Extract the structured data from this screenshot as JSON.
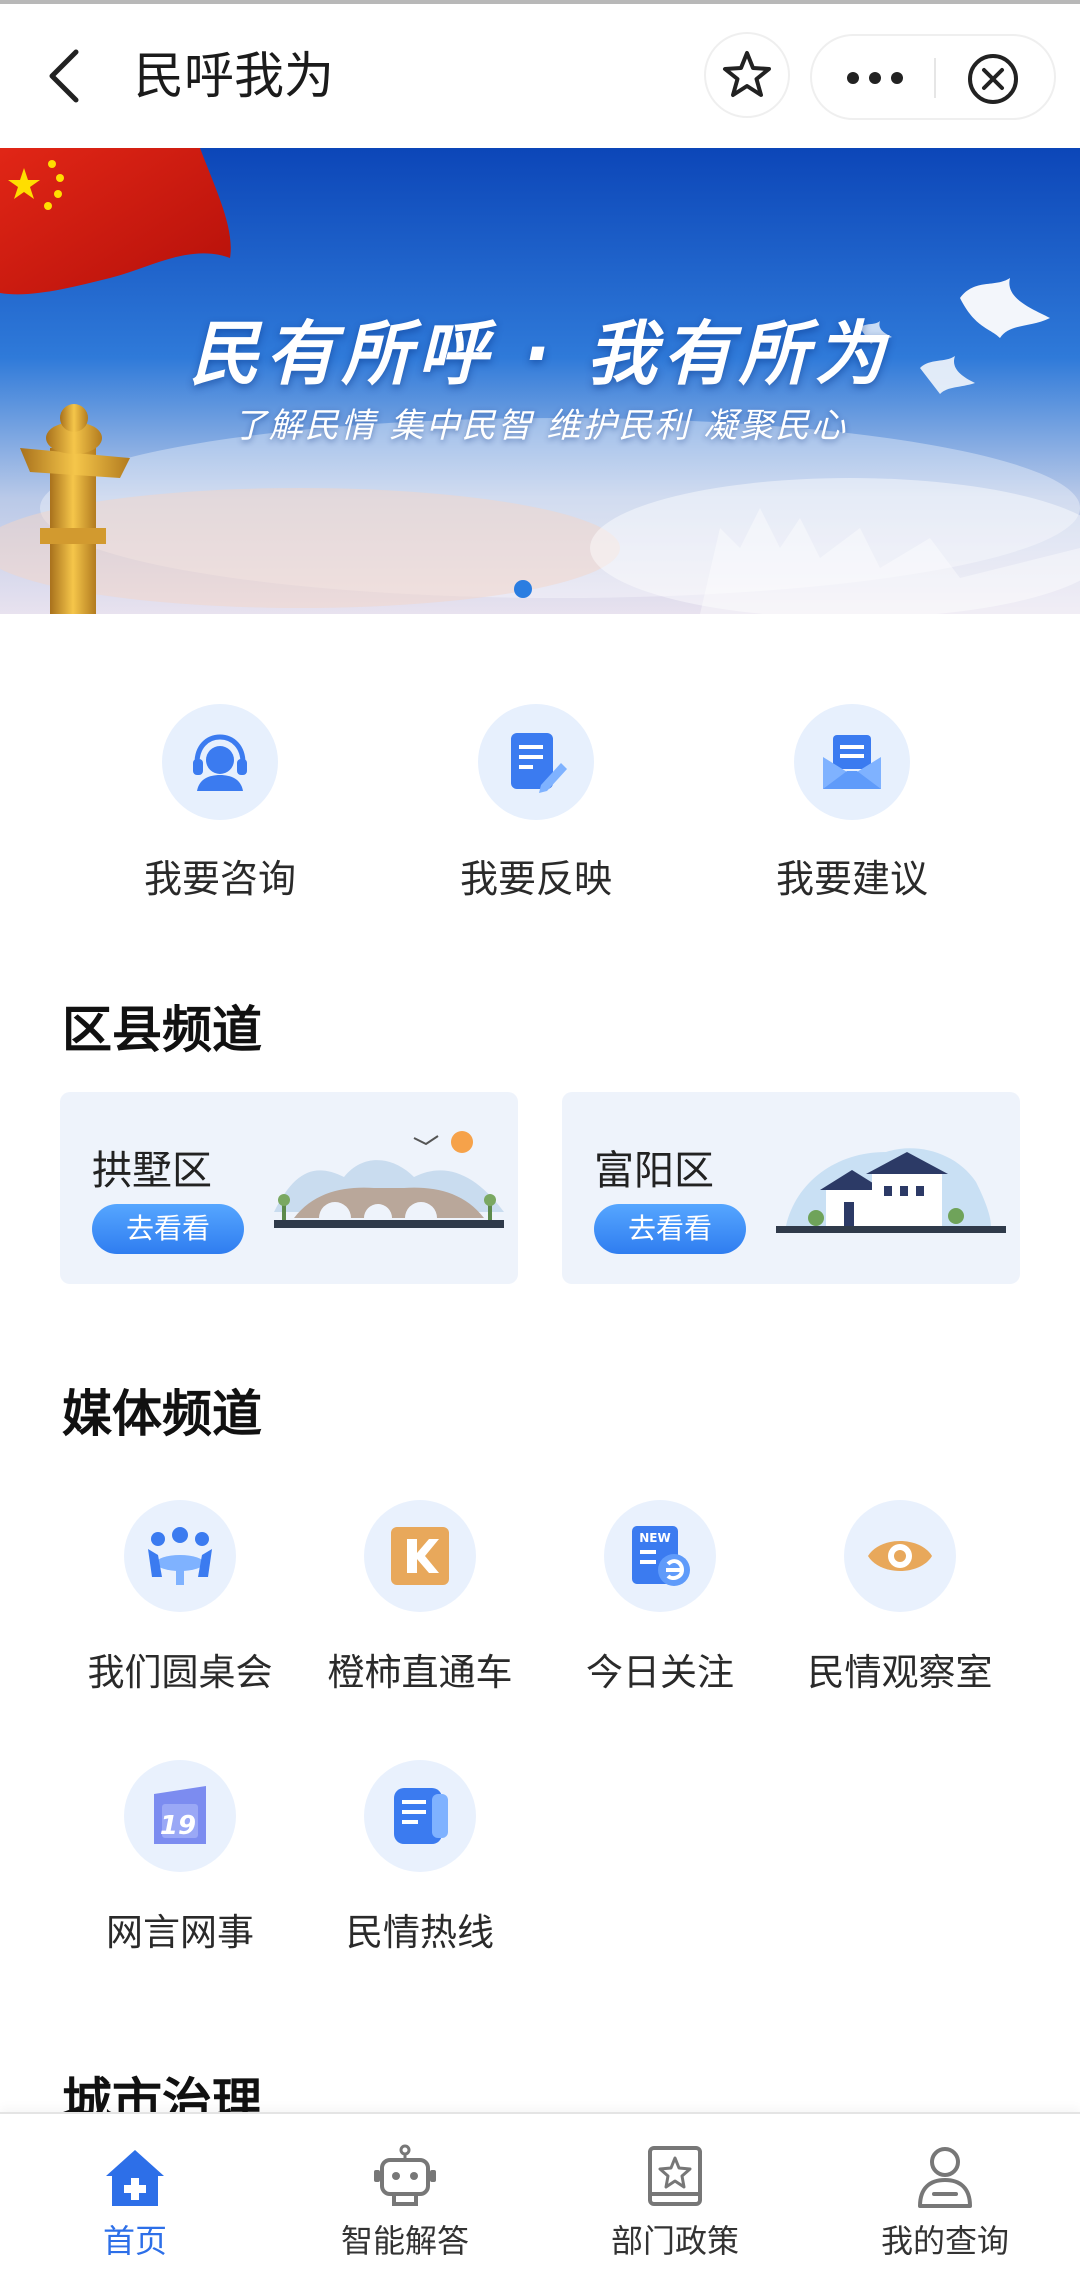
{
  "header": {
    "title": "民呼我为"
  },
  "banner": {
    "title": "民有所呼 · 我有所为",
    "subtitle": "了解民情 集中民智 维护民利 凝聚民心"
  },
  "quick_actions": [
    {
      "label": "我要咨询",
      "icon": "customer-service-icon"
    },
    {
      "label": "我要反映",
      "icon": "edit-document-icon"
    },
    {
      "label": "我要建议",
      "icon": "mail-icon"
    }
  ],
  "sections": {
    "district": "区县频道",
    "media": "媒体频道",
    "city": "城市治理"
  },
  "districts": [
    {
      "name": "拱墅区",
      "button": "去看看"
    },
    {
      "name": "富阳区",
      "button": "去看看"
    }
  ],
  "media": [
    {
      "label": "我们圆桌会",
      "icon": "round-table-icon"
    },
    {
      "label": "橙柿直通车",
      "icon": "k-logo-icon"
    },
    {
      "label": "今日关注",
      "icon": "news-icon"
    },
    {
      "label": "民情观察室",
      "icon": "eye-icon"
    },
    {
      "label": "网言网事",
      "icon": "19-logo-icon"
    },
    {
      "label": "民情热线",
      "icon": "hotline-icon"
    }
  ],
  "tabs": [
    {
      "label": "首页",
      "icon": "home-icon",
      "active": true
    },
    {
      "label": "智能解答",
      "icon": "robot-icon",
      "active": false
    },
    {
      "label": "部门政策",
      "icon": "policy-book-icon",
      "active": false
    },
    {
      "label": "我的查询",
      "icon": "user-icon",
      "active": false
    }
  ],
  "colors": {
    "accent": "#2d6fe8",
    "icon_bg": "#e7f0fd",
    "card_bg": "#eef3fb"
  }
}
